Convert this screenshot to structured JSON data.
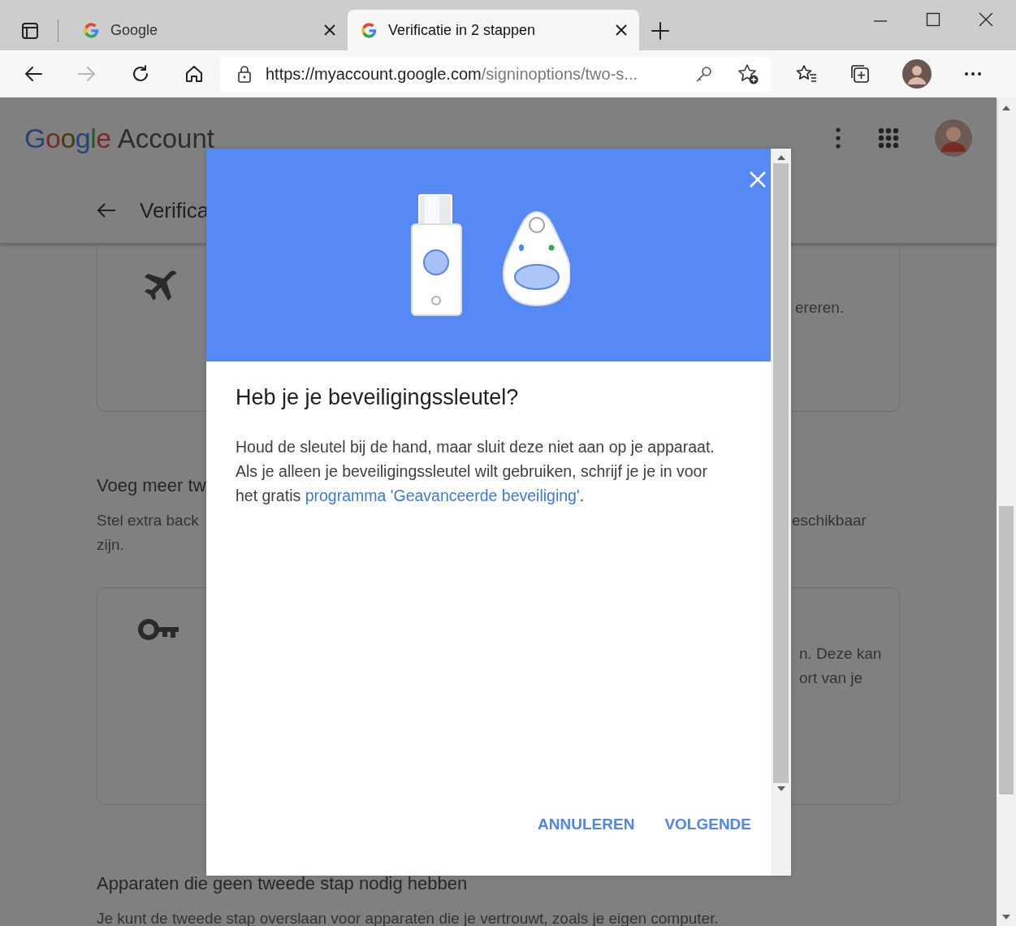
{
  "browser": {
    "tabs": [
      {
        "title": "Google",
        "selected": false
      },
      {
        "title": "Verificatie in 2 stappen",
        "selected": true
      }
    ],
    "forward_disabled": true,
    "address": {
      "host": "https://myaccount.google.com",
      "path": "/signinoptions/two-s..."
    }
  },
  "page": {
    "logo": {
      "brand": "Google",
      "product": "Account"
    },
    "page_title": "Verifica",
    "blocks": [
      {
        "kind": "card",
        "right_lines": [
          "ereren."
        ]
      },
      {
        "kind": "section",
        "heading": "Voeg meer tw",
        "lines": [
          {
            "left": "Stel extra back",
            "right": "eschikbaar"
          },
          {
            "left": "zijn."
          }
        ]
      },
      {
        "kind": "card",
        "right_lines": [
          "n. Deze kan",
          "ort van je"
        ]
      },
      {
        "kind": "section",
        "heading": "Apparaten die geen tweede stap nodig hebben",
        "lines": [
          {
            "left": "Je kunt de tweede stap overslaan voor apparaten die je vertrouwt, zoals je eigen computer."
          }
        ]
      }
    ]
  },
  "dialog": {
    "title": "Heb je je beveiligingssleutel?",
    "paragraphs": [
      {
        "text": "Houd de sleutel bij de hand, maar sluit deze niet aan op je apparaat."
      },
      {
        "text": "Als je alleen je beveiligingssleutel wilt gebruiken, schrijf je je in voor het gratis ",
        "link": "programma 'Geavanceerde beveiliging'",
        "after": "."
      }
    ],
    "buttons": [
      "ANNULEREN",
      "VOLGENDE"
    ]
  }
}
